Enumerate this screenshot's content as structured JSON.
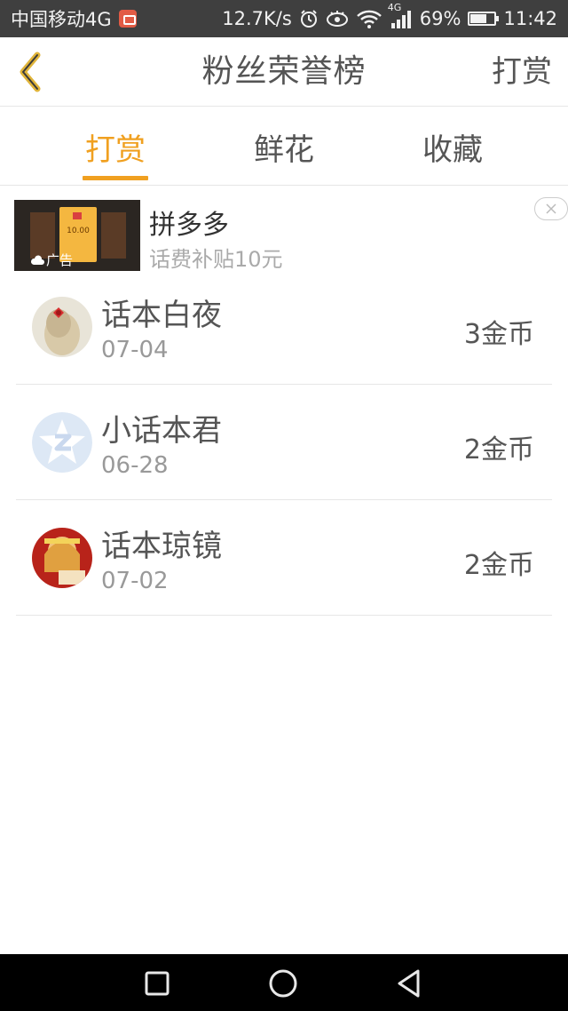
{
  "status_bar": {
    "carrier": "中国移动4G",
    "speed": "12.7K/s",
    "network": "4G",
    "battery": "69%",
    "battery_level": 0.69,
    "time": "11:42"
  },
  "header": {
    "title": "粉丝荣誉榜",
    "action_label": "打赏"
  },
  "tabs": [
    {
      "label": "打赏",
      "active": true
    },
    {
      "label": "鲜花",
      "active": false
    },
    {
      "label": "收藏",
      "active": false
    }
  ],
  "ad": {
    "title": "拼多多",
    "subtitle": "话费补贴10元",
    "tag": "广告",
    "card_price": "10.00"
  },
  "fans": [
    {
      "name": "话本白夜",
      "date": "07-04",
      "coins": "3金币"
    },
    {
      "name": "小话本君",
      "date": "06-28",
      "coins": "2金币"
    },
    {
      "name": "话本琼镜",
      "date": "07-02",
      "coins": "2金币"
    }
  ],
  "colors": {
    "accent": "#f0a020",
    "status_bar": "#3f3f3f",
    "text": "#555555",
    "muted": "#999999"
  }
}
